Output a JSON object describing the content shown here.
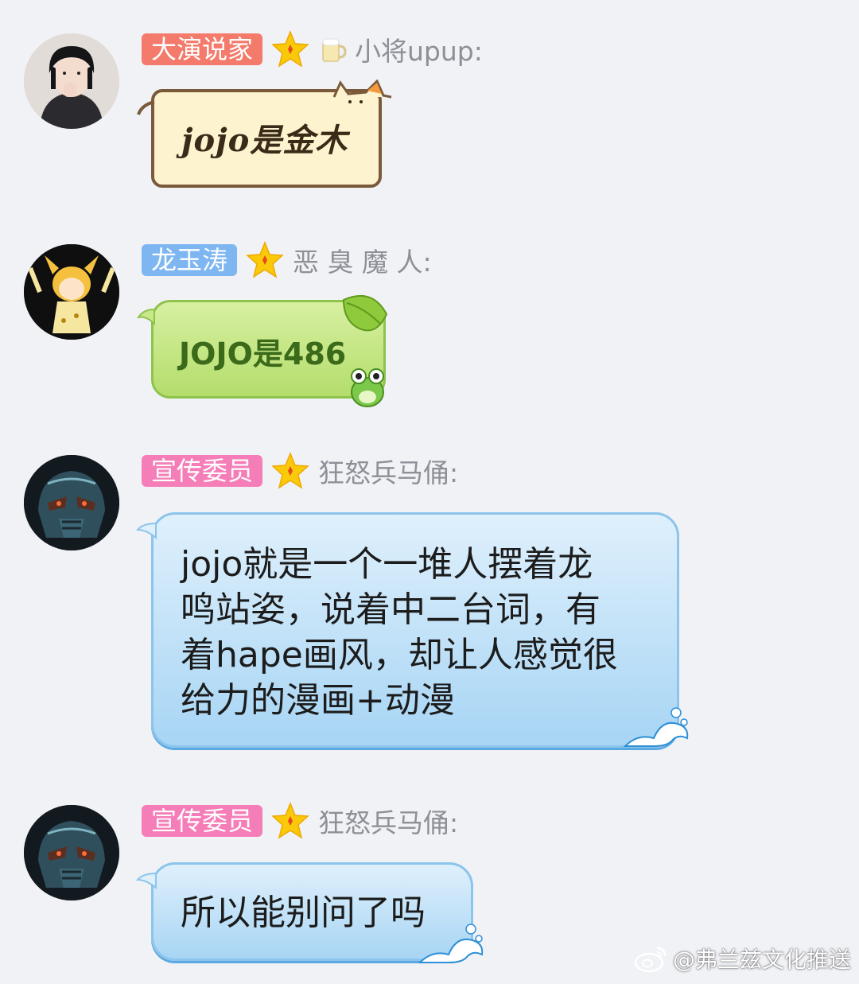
{
  "messages": [
    {
      "title": "大演说家",
      "title_color": "#f47a6b",
      "nickname": "小将upup:",
      "text": "jojo是金木",
      "bubble_style": "cat"
    },
    {
      "title": "龙玉涛",
      "title_color": "#7eb6f2",
      "nickname": "恶 臭 魔 人:",
      "text": "JOJO是486",
      "bubble_style": "leaf"
    },
    {
      "title": "宣传委员",
      "title_color": "#f57eb8",
      "nickname": "狂怒兵马俑:",
      "text": "jojo就是一个一堆人摆着龙\n鸣站姿，说着中二台词，有\n着hape画风，却让人感觉很\n给力的漫画+动漫",
      "bubble_style": "blue"
    },
    {
      "title": "宣传委员",
      "title_color": "#f57eb8",
      "nickname": "狂怒兵马俑:",
      "text": "所以能别问了吗",
      "bubble_style": "blue"
    }
  ],
  "icons": {
    "rank": "star-icon",
    "drink": "beer-mug-icon",
    "watermark_logo": "weibo-logo-icon"
  },
  "watermark": "@弗兰兹文化推送"
}
